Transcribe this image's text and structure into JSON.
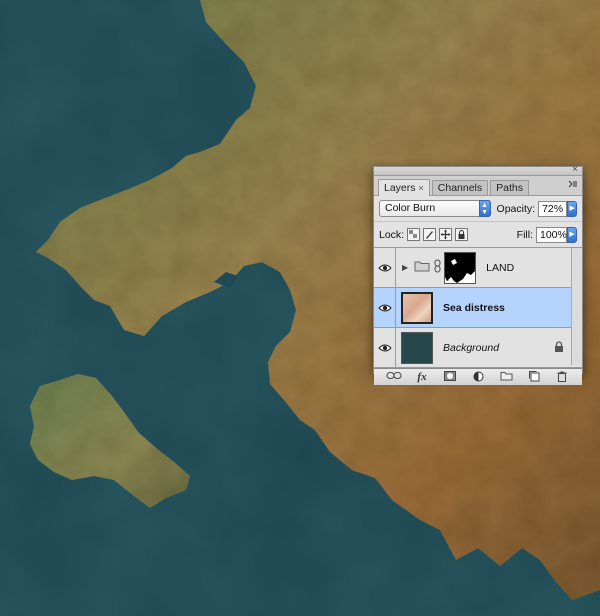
{
  "panel": {
    "tabs": [
      {
        "label": "Layers",
        "active": true,
        "has_close": true
      },
      {
        "label": "Channels",
        "active": false
      },
      {
        "label": "Paths",
        "active": false
      }
    ],
    "close_glyph": "×",
    "blend_mode": "Color Burn",
    "opacity_label": "Opacity:",
    "opacity_value": "72%",
    "lock_label": "Lock:",
    "fill_label": "Fill:",
    "fill_value": "100%",
    "layers": [
      {
        "name": "LAND",
        "type": "group",
        "visible": true,
        "selected": false,
        "has_mask": true,
        "style": "normal"
      },
      {
        "name": "Sea distress",
        "type": "layer",
        "visible": true,
        "selected": true,
        "style": "bold"
      },
      {
        "name": "Background",
        "type": "background",
        "visible": true,
        "selected": false,
        "locked": true,
        "style": "italic"
      }
    ],
    "bottom_icons": [
      "link-icon",
      "fx-icon",
      "mask-icon",
      "adjustment-icon",
      "folder-icon",
      "new-layer-icon",
      "trash-icon"
    ],
    "fx_label": "fx"
  },
  "colors": {
    "sea": "#1d4650",
    "land": "#8a7a4a",
    "selection": "#b5d4fd",
    "accent": "#2f6fd0"
  }
}
